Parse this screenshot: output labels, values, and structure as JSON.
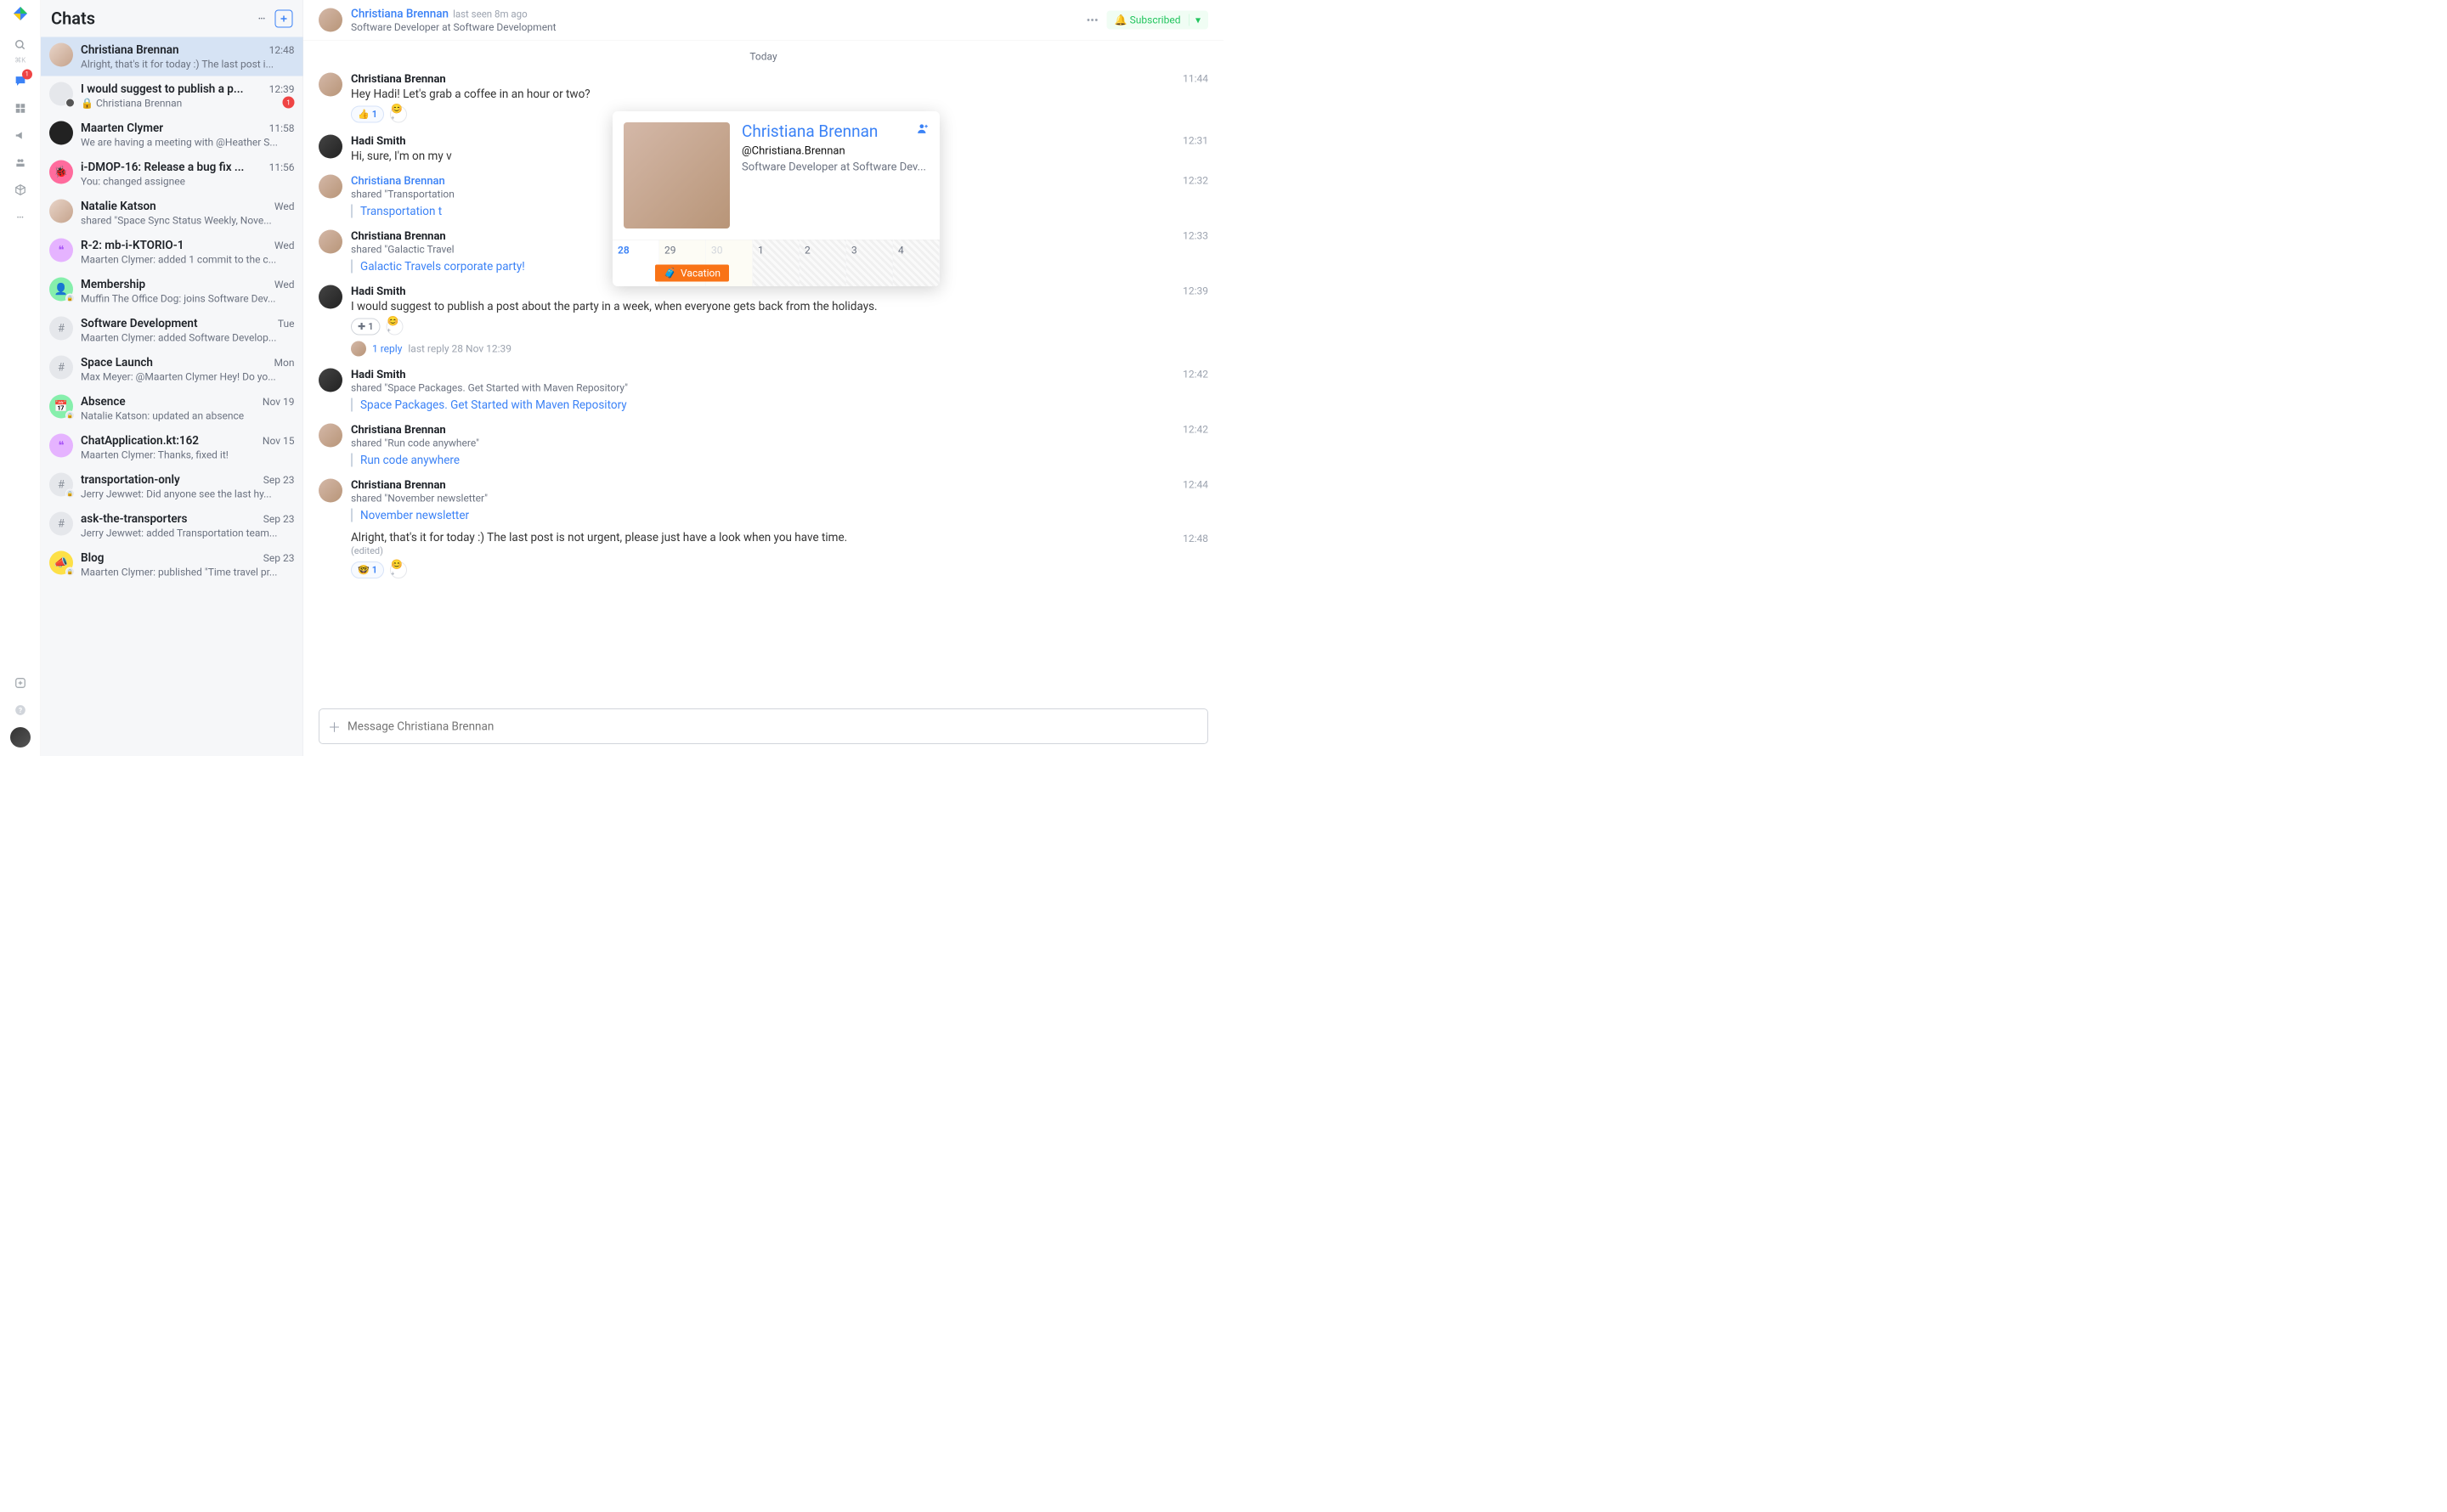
{
  "leftrail": {
    "badge_chat": "1"
  },
  "sidebar": {
    "title": "Chats",
    "items": [
      {
        "name": "Christiana Brennan",
        "time": "12:48",
        "preview": "Alright, that's it for today :) The last post i...",
        "av": "c1"
      },
      {
        "name": "I would suggest to publish a p...",
        "time": "12:39",
        "preview": "Christiana Brennan",
        "av": "c2",
        "unread": "1",
        "locked": true,
        "mini": true
      },
      {
        "name": "Maarten Clymer",
        "time": "11:58",
        "preview": "We are having a meeting with @Heather S...",
        "av": "c3"
      },
      {
        "name": "i-DMOP-16: Release a bug fix ...",
        "time": "11:56",
        "preview": "You: changed assignee",
        "av": "c4",
        "emoji": "🐞"
      },
      {
        "name": "Natalie Katson",
        "time": "Wed",
        "preview": "shared \"Space Sync Status Weekly, Nove...",
        "av": "c1"
      },
      {
        "name": "R-2: mb-i-KTORIO-1",
        "time": "Wed",
        "preview": "Maarten Clymer: added 1 commit to the c...",
        "av": "c5",
        "emoji": "❝"
      },
      {
        "name": "Membership",
        "time": "Wed",
        "preview": "Muffin The Office Dog: joins Software Dev...",
        "av": "c6",
        "emoji": "👤",
        "lockMini": true
      },
      {
        "name": "Software Development",
        "time": "Tue",
        "preview": "Maarten Clymer: added Software Develop...",
        "av": "c2",
        "emoji": "#"
      },
      {
        "name": "Space Launch",
        "time": "Mon",
        "preview": "Max Meyer: @Maarten Clymer Hey! Do yo...",
        "av": "c2",
        "emoji": "#"
      },
      {
        "name": "Absence",
        "time": "Nov 19",
        "preview": "Natalie Katson: updated an absence",
        "av": "c6",
        "emoji": "📅",
        "lockMini": true
      },
      {
        "name": "ChatApplication.kt:162",
        "time": "Nov 15",
        "preview": "Maarten Clymer: Thanks, fixed it!",
        "av": "c5",
        "emoji": "❝"
      },
      {
        "name": "transportation-only",
        "time": "Sep 23",
        "preview": "Jerry Jewwet: Did anyone see the last hy...",
        "av": "c2",
        "emoji": "#",
        "lockMini": true
      },
      {
        "name": "ask-the-transporters",
        "time": "Sep 23",
        "preview": "Jerry Jewwet: added Transportation team...",
        "av": "c2",
        "emoji": "#"
      },
      {
        "name": "Blog",
        "time": "Sep 23",
        "preview": "Maarten Clymer: published \"Time travel pr...",
        "av": "c7",
        "emoji": "📣",
        "lockMini": true
      }
    ]
  },
  "header": {
    "name": "Christiana Brennan",
    "status": "last seen 8m ago",
    "sub": "Software Developer at Software Development",
    "subscribe": "Subscribed"
  },
  "date_sep": "Today",
  "messages": [
    {
      "author": "Christiana Brennan",
      "av": "cb",
      "text": "Hey Hadi! Let's grab a coffee in an hour or two?",
      "time": "11:44",
      "react": "👍",
      "rcount": "1"
    },
    {
      "author": "Hadi Smith",
      "av": "hs",
      "text": "Hi, sure, I'm on my v",
      "time": "12:31"
    },
    {
      "author": "Christiana Brennan",
      "av": "cb",
      "link": true,
      "sub": "shared \"Transportation",
      "share": "Transportation t",
      "time": "12:32"
    },
    {
      "author": "Christiana Brennan",
      "av": "cb",
      "sub": "shared \"Galactic Travel",
      "share": "Galactic Travels corporate party!",
      "time": "12:33"
    },
    {
      "author": "Hadi Smith",
      "av": "hs",
      "text": "I would suggest to publish a post about the party in a week, when everyone gets back from the holidays.",
      "time": "12:39",
      "plusreact": "1",
      "thread_replies": "1 reply",
      "thread_last": "last reply 28 Nov 12:39"
    },
    {
      "author": "Hadi Smith",
      "av": "hs",
      "sub": "shared \"Space Packages. Get Started with Maven Repository\"",
      "share": "Space Packages. Get Started with Maven Repository",
      "time": "12:42"
    },
    {
      "author": "Christiana Brennan",
      "av": "cb",
      "sub": "shared \"Run code anywhere\"",
      "share": "Run code anywhere",
      "time": "12:42"
    },
    {
      "author": "Christiana Brennan",
      "av": "cb",
      "sub": "shared \"November newsletter\"",
      "share": "November newsletter",
      "time": "12:44",
      "text2": "Alright, that's it for today :) The last post is not urgent, please just have a look when you have time.",
      "time2": "12:48",
      "edited": "(edited)",
      "react2": "🤓",
      "r2count": "1"
    }
  ],
  "composer": {
    "placeholder": "Message Christiana Brennan"
  },
  "hovercard": {
    "name": "Christiana Brennan",
    "handle": "@Christiana.Brennan",
    "role": "Software Developer at Software Dev...",
    "days": [
      "28",
      "29",
      "30",
      "1",
      "2",
      "3",
      "4"
    ],
    "event": "Vacation"
  }
}
